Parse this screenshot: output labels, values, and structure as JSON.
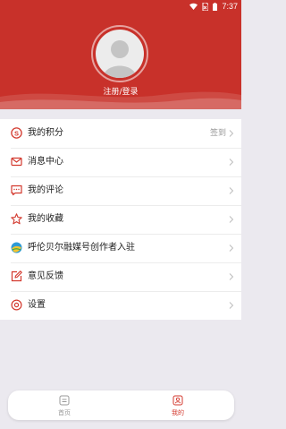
{
  "status_bar": {
    "time": "7:37"
  },
  "profile": {
    "login_label": "注册/登录"
  },
  "menu": [
    {
      "label": "我的积分",
      "aside": "签到",
      "icon": "points-icon"
    },
    {
      "label": "消息中心",
      "aside": "",
      "icon": "mail-icon"
    },
    {
      "label": "我的评论",
      "aside": "",
      "icon": "comment-icon"
    },
    {
      "label": "我的收藏",
      "aside": "",
      "icon": "star-icon"
    },
    {
      "label": "呼伦贝尔融媒号创作者入驻",
      "aside": "",
      "icon": "media-logo-icon"
    },
    {
      "label": "意见反馈",
      "aside": "",
      "icon": "feedback-icon"
    },
    {
      "label": "设置",
      "aside": "",
      "icon": "settings-icon"
    }
  ],
  "tabs": [
    {
      "label": "首页",
      "active": false,
      "icon": "home-icon"
    },
    {
      "label": "我的",
      "active": true,
      "icon": "profile-icon"
    }
  ],
  "colors": {
    "brand_red": "#c8312a",
    "accent_red": "#d33a2f",
    "inactive_tab": "#999999"
  }
}
